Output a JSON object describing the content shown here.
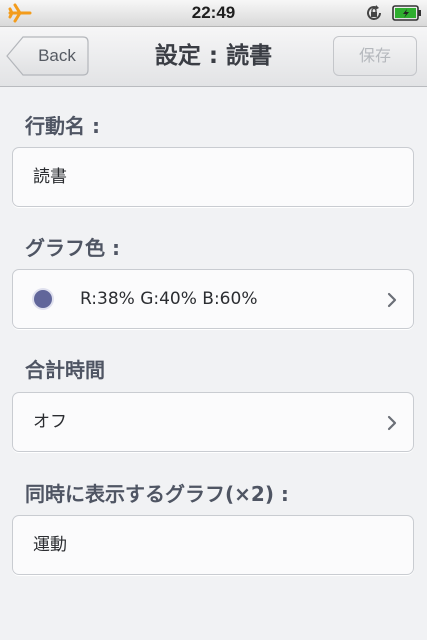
{
  "status_bar": {
    "time": "22:49",
    "icons": [
      "airplane-mode-icon",
      "orientation-lock-icon",
      "battery-charging-icon"
    ]
  },
  "nav": {
    "back_label": "Back",
    "title": "設定 : 読書",
    "save_label": "保存"
  },
  "form": {
    "action_name": {
      "label": "行動名 :",
      "value": "読書"
    },
    "graph_color": {
      "label": "グラフ色 :",
      "value": "R:38% G:40% B:60%",
      "swatch": "#61669a"
    },
    "total_time": {
      "label": "合計時間",
      "value": "オフ"
    },
    "simultaneous_graph": {
      "label": "同時に表示するグラフ(×2) :",
      "value": "運動"
    }
  },
  "colors": {
    "airplane": "#f39c1c",
    "battery": "#2fae2f",
    "label_text": "#4f5563"
  }
}
